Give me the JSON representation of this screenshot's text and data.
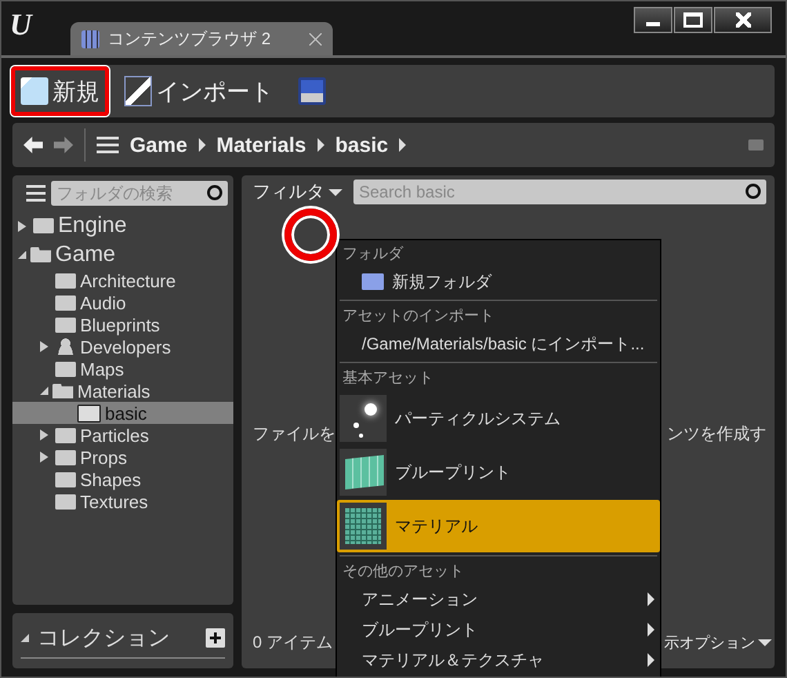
{
  "window": {
    "logo": "U",
    "tab_title": "コンテンツブラウザ 2"
  },
  "toolbar": [
    {
      "label": "新規",
      "kind": "new",
      "highlighted": true
    },
    {
      "label": "インポート",
      "kind": "import",
      "highlighted": false
    },
    {
      "kind": "save",
      "highlighted": false
    }
  ],
  "breadcrumb": [
    "Game",
    "Materials",
    "basic"
  ],
  "sidebar": {
    "search": {
      "placeholder": "フォルダの検索"
    },
    "tree": [
      {
        "label": "Engine",
        "expanded": false,
        "selected": false
      },
      {
        "label": "Game",
        "expanded": true,
        "selected": false,
        "children": [
          {
            "label": "Architecture",
            "selected": false
          },
          {
            "label": "Audio",
            "selected": false
          },
          {
            "label": "Blueprints",
            "selected": false
          },
          {
            "label": "Developers",
            "kind": "user",
            "expanded": false,
            "selected": false
          },
          {
            "label": "Maps",
            "selected": false
          },
          {
            "label": "Materials",
            "expanded": true,
            "selected": false,
            "children": [
              {
                "label": "basic",
                "selected": true
              }
            ]
          },
          {
            "label": "Particles",
            "expanded": false,
            "selected": false
          },
          {
            "label": "Props",
            "expanded": false,
            "selected": false
          },
          {
            "label": "Shapes",
            "selected": false
          },
          {
            "label": "Textures",
            "selected": false
          }
        ]
      }
    ],
    "collections": {
      "label": "コレクション",
      "expanded": true
    }
  },
  "content": {
    "filter": "フィルタ",
    "search": {
      "placeholder": "Search basic"
    },
    "hint_left": "ファイルを",
    "hint_right": "ンツを作成す",
    "item_count": "0 アイテム",
    "view_options": "示オプション"
  },
  "menu": {
    "sections": [
      {
        "heading": "フォルダ",
        "items": [
          {
            "label": "新規フォルダ",
            "kind": "folder",
            "selected": false
          }
        ]
      },
      {
        "heading": "アセットのインポート",
        "items": [
          {
            "label": "/Game/Materials/basic にインポート...",
            "kind": "plain",
            "selected": false
          }
        ]
      },
      {
        "heading": "基本アセット",
        "items": [
          {
            "label": "パーティクルシステム",
            "kind": "particle",
            "selected": false
          },
          {
            "label": "ブループリント",
            "kind": "blueprint",
            "selected": false
          },
          {
            "label": "マテリアル",
            "kind": "material",
            "selected": true
          }
        ]
      },
      {
        "heading": "その他のアセット",
        "items": [
          {
            "label": "アニメーション",
            "kind": "submenu",
            "selected": false
          },
          {
            "label": "ブループリント",
            "kind": "submenu",
            "selected": false
          },
          {
            "label": "マテリアル＆テクスチャ",
            "kind": "submenu",
            "selected": false
          }
        ]
      }
    ]
  }
}
